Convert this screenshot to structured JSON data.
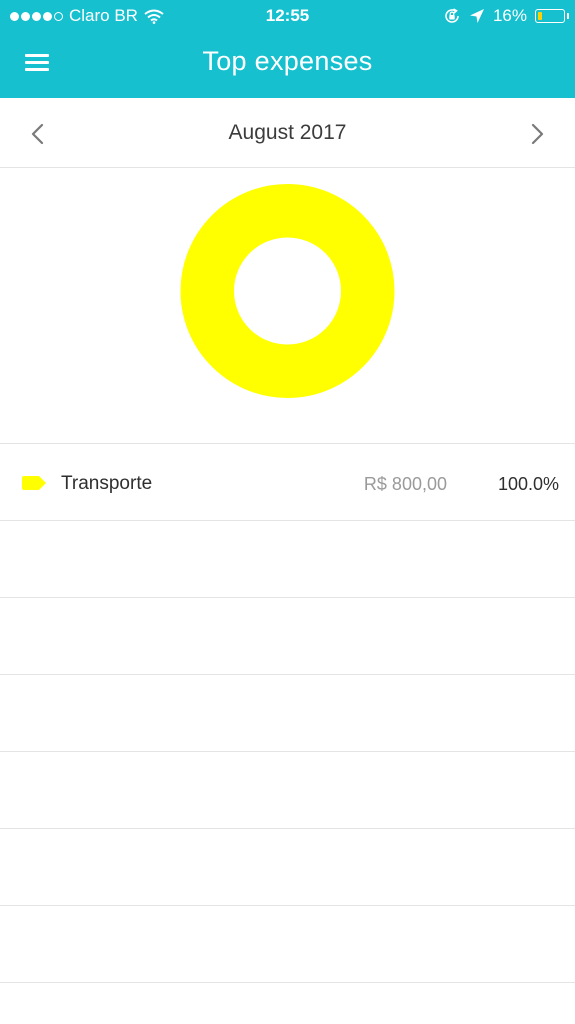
{
  "status_bar": {
    "signal_filled": 4,
    "signal_total": 5,
    "carrier": "Claro BR",
    "time": "12:55",
    "battery_percent_text": "16%",
    "battery_level": 0.16,
    "battery_color": "#ffd200",
    "icons": [
      "wifi-icon",
      "orientation-lock-icon",
      "location-arrow-icon",
      "battery-icon"
    ]
  },
  "header": {
    "title": "Top expenses",
    "background_color": "#16c0cf",
    "menu_icon": "hamburger-menu-icon"
  },
  "month_nav": {
    "label": "August 2017",
    "prev_icon": "chevron-left-icon",
    "next_icon": "chevron-right-icon"
  },
  "chart_data": {
    "type": "pie",
    "donut": true,
    "categories": [
      "Transporte"
    ],
    "values": [
      100.0
    ],
    "colors": [
      "#ffff00"
    ]
  },
  "categories": [
    {
      "name": "Transporte",
      "amount": "R$ 800,00",
      "percent": "100.0%",
      "color": "#ffff00",
      "icon": "tag-icon"
    }
  ],
  "empty_rows": 6
}
